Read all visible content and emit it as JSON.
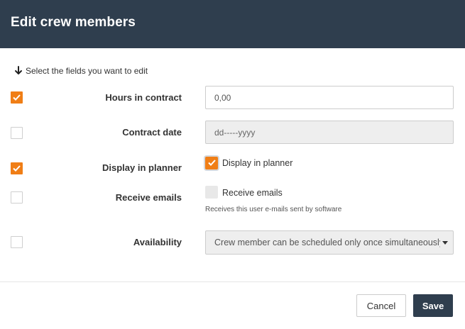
{
  "dialog": {
    "title": "Edit crew members",
    "intro": "Select the fields you want to edit"
  },
  "fields": {
    "hours": {
      "label": "Hours in contract",
      "checked": true,
      "value": "0,00"
    },
    "contract_date": {
      "label": "Contract date",
      "checked": false,
      "placeholder": "dd-----yyyy"
    },
    "display_planner": {
      "label": "Display in planner",
      "checked": true,
      "option_label": "Display in planner",
      "option_checked": true
    },
    "receive_emails": {
      "label": "Receive emails",
      "checked": false,
      "option_label": "Receive emails",
      "option_checked": false,
      "help": "Receives this user e-mails sent by software"
    },
    "availability": {
      "label": "Availability",
      "checked": false,
      "selected": "Crew member can be scheduled only once simultaneously"
    }
  },
  "footer": {
    "cancel_label": "Cancel",
    "save_label": "Save"
  },
  "colors": {
    "header": "#2f3e4e",
    "accent": "#f07e16",
    "save_button": "#2f3e4e"
  },
  "icons": {
    "intro": "arrow-down-icon",
    "check": "checkmark-icon",
    "select": "caret-down-icon"
  }
}
